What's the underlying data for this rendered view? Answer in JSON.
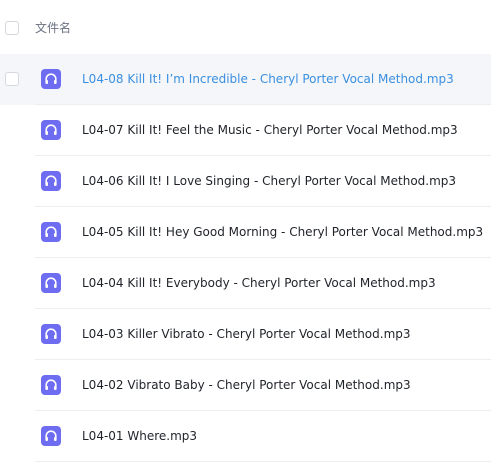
{
  "header": {
    "column_label": "文件名"
  },
  "files": [
    {
      "name": "L04-08 Kill It! I’m Incredible - Cheryl Porter Vocal Method.mp3",
      "icon": "headphones-icon",
      "highlighted": true
    },
    {
      "name": "L04-07 Kill It! Feel the Music - Cheryl Porter Vocal Method.mp3",
      "icon": "headphones-icon",
      "highlighted": false
    },
    {
      "name": "L04-06 Kill It! I Love Singing - Cheryl Porter Vocal Method.mp3",
      "icon": "headphones-icon",
      "highlighted": false
    },
    {
      "name": "L04-05 Kill It! Hey Good Morning - Cheryl Porter Vocal Method.mp3",
      "icon": "headphones-icon",
      "highlighted": false
    },
    {
      "name": "L04-04 Kill It! Everybody - Cheryl Porter Vocal Method.mp3",
      "icon": "headphones-icon",
      "highlighted": false
    },
    {
      "name": "L04-03 Killer Vibrato - Cheryl Porter Vocal Method.mp3",
      "icon": "headphones-icon",
      "highlighted": false
    },
    {
      "name": "L04-02 Vibrato Baby - Cheryl Porter Vocal Method.mp3",
      "icon": "headphones-icon",
      "highlighted": false
    },
    {
      "name": "L04-01 Where.mp3",
      "icon": "headphones-icon",
      "highlighted": false
    }
  ],
  "colors": {
    "icon_bg": "#6e6cf0",
    "highlight_text": "#3b8fe0",
    "highlight_bg": "#f4f6f9"
  }
}
